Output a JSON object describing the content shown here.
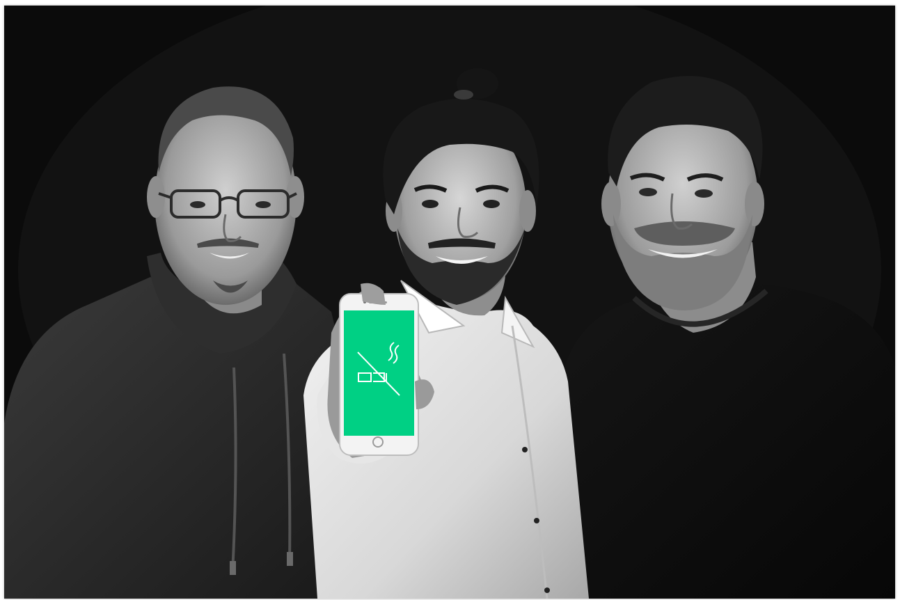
{
  "image": {
    "subjects": [
      {
        "name": "left-person"
      },
      {
        "name": "center-person"
      },
      {
        "name": "right-person"
      }
    ],
    "phone_screen_color": "#00d084",
    "phone_icon": "no-smoking-icon",
    "background_color": "#0b0b0b"
  }
}
